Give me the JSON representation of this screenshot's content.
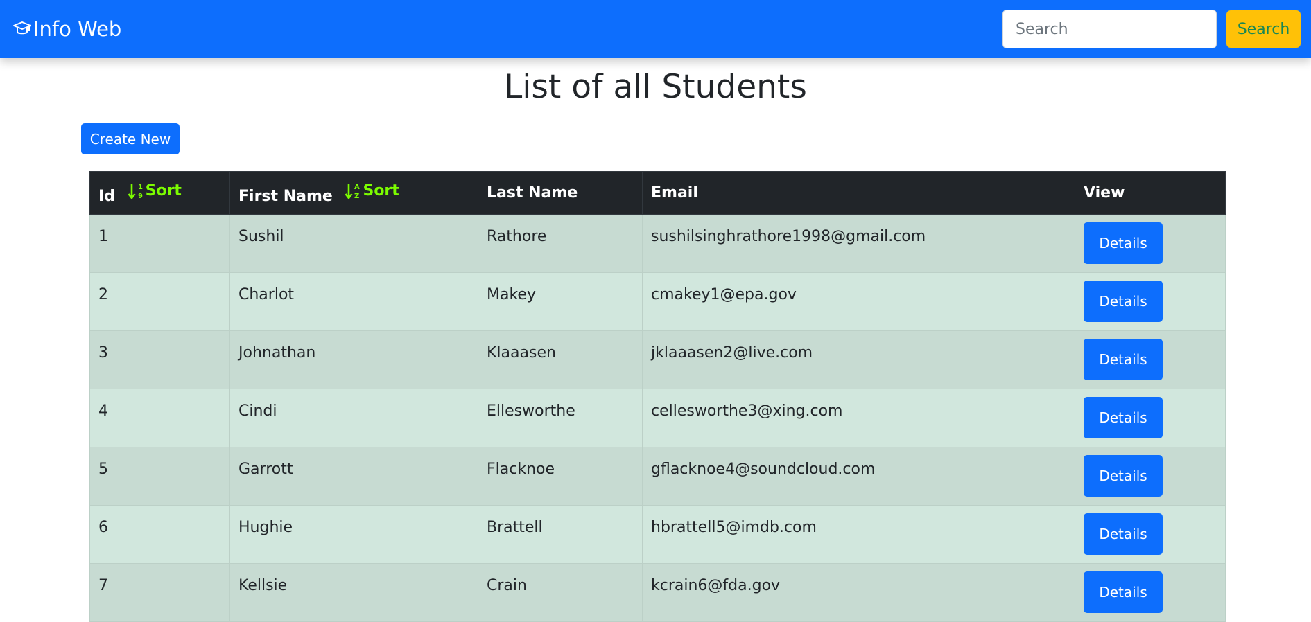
{
  "navbar": {
    "brand_icon": "graduation-cap-icon",
    "brand_label": "Info Web",
    "search_placeholder": "Search",
    "search_value": "",
    "search_button_label": "Search",
    "colors": {
      "navbar": "#0d6efd",
      "search_button": "#ffc107",
      "search_button_text": "#198754"
    }
  },
  "main": {
    "title": "List of all Students",
    "create_button_label": "Create New"
  },
  "table": {
    "headers": {
      "id": "Id",
      "first_name": "First Name",
      "last_name": "Last Name",
      "email": "Email",
      "view": "View"
    },
    "sort_label": "Sort",
    "sort_icons": {
      "id": "sort-numeric-down-icon",
      "first_name": "sort-alpha-down-icon"
    },
    "sort_color": "#7cfc00",
    "details_label": "Details",
    "rows": [
      {
        "id": "1",
        "first_name": "Sushil",
        "last_name": "Rathore",
        "email": "sushilsinghrathore1998@gmail.com"
      },
      {
        "id": "2",
        "first_name": "Charlot",
        "last_name": "Makey",
        "email": "cmakey1@epa.gov"
      },
      {
        "id": "3",
        "first_name": "Johnathan",
        "last_name": "Klaaasen",
        "email": "jklaaasen2@live.com"
      },
      {
        "id": "4",
        "first_name": "Cindi",
        "last_name": "Ellesworthe",
        "email": "cellesworthe3@xing.com"
      },
      {
        "id": "5",
        "first_name": "Garrott",
        "last_name": "Flacknoe",
        "email": "gflacknoe4@soundcloud.com"
      },
      {
        "id": "6",
        "first_name": "Hughie",
        "last_name": "Brattell",
        "email": "hbrattell5@imdb.com"
      },
      {
        "id": "7",
        "first_name": "Kellsie",
        "last_name": "Crain",
        "email": "kcrain6@fda.gov"
      }
    ]
  }
}
